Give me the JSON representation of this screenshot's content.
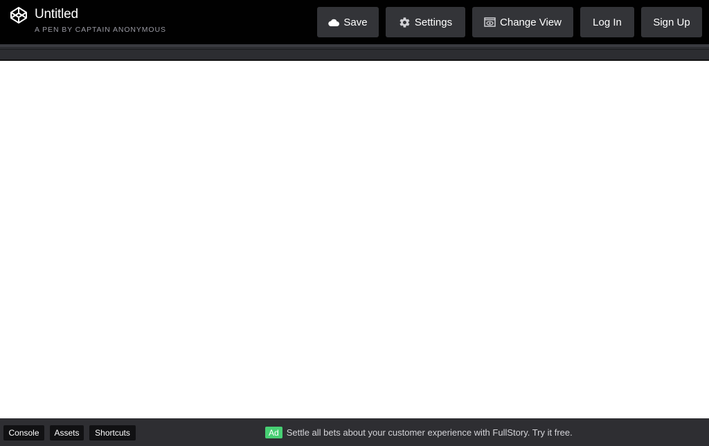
{
  "header": {
    "logo_icon": "codepen-logo-icon",
    "title": "Untitled",
    "author": "A PEN BY CAPTAIN ANONYMOUS",
    "buttons": {
      "save": {
        "label": "Save",
        "icon": "cloud-icon"
      },
      "settings": {
        "label": "Settings",
        "icon": "gear-icon"
      },
      "change_view": {
        "label": "Change View",
        "icon": "eye-window-icon"
      },
      "login": {
        "label": "Log In"
      },
      "signup": {
        "label": "Sign Up"
      }
    }
  },
  "footer": {
    "tabs": [
      "Console",
      "Assets",
      "Shortcuts"
    ],
    "ad": {
      "badge": "Ad",
      "text": "Settle all bets about your customer experience with FullStory. Try it free.",
      "badge_color": "#47cf73"
    }
  },
  "colors": {
    "header_bg": "#010101",
    "button_bg": "#333438",
    "footer_bg": "#2e2e32"
  }
}
